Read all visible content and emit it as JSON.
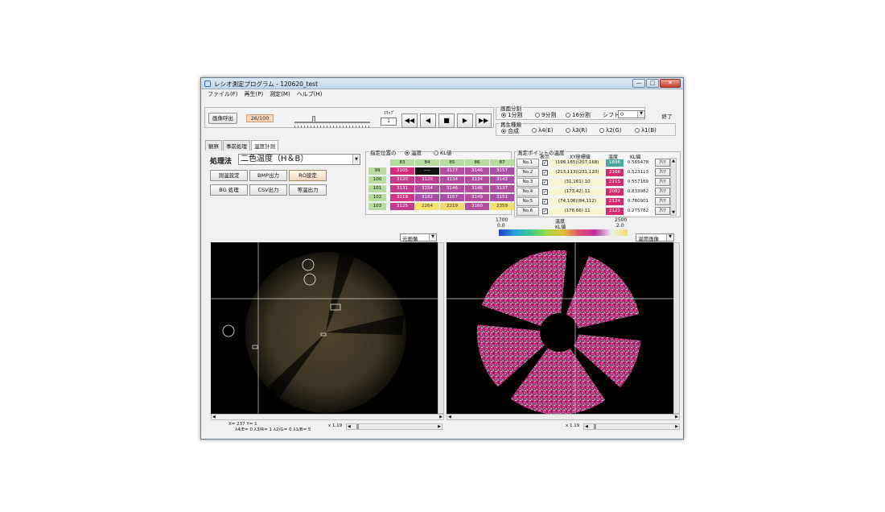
{
  "window": {
    "title": "レシオ測定プログラム - 120620_test",
    "min": "—",
    "max": "□",
    "close": "✕"
  },
  "menu": [
    "ファイル(F)",
    "再生(P)",
    "測定(M)",
    "ヘルプ(H)"
  ],
  "toolbar": {
    "load_button": "画像呼出",
    "frame_counter": "26/100",
    "skip_label": "ｽｷｯﾌﾟ",
    "skip_value": "1",
    "rewind": "◀◀",
    "prev": "◀",
    "stop": "■",
    "play": "▶",
    "ffwd": "▶▶"
  },
  "screen_split": {
    "label": "画面分割",
    "options": [
      "1分割",
      "9分割",
      "16分割"
    ],
    "selected": "1分割",
    "shift_label": "シフト",
    "shift_value": "0",
    "exit_button": "終了"
  },
  "playback_type": {
    "label": "再生種類",
    "options": [
      "合成",
      "λ4(E)",
      "λ3(R)",
      "λ2(G)",
      "λ1(B)"
    ],
    "selected": "合成"
  },
  "tabs": [
    "観察",
    "事前処理",
    "温度計測"
  ],
  "active_tab": "温度計測",
  "method": {
    "label": "処理法",
    "value": "二色温度（H＆B）"
  },
  "buttons": [
    "測温設定",
    "BMP出力",
    "RO設定",
    "BG 処理",
    "CSV出力",
    "等温出力"
  ],
  "position_table": {
    "label": "指定位置の",
    "mode_options": [
      "温度",
      "KL値"
    ],
    "mode_selected": "温度",
    "columns": [
      "83",
      "84",
      "85",
      "86",
      "87"
    ],
    "rows": [
      {
        "y": "99",
        "cells": [
          "3105",
          "----",
          "3177",
          "3146",
          "3157"
        ],
        "colors": [
          "#d42c7a",
          "#111111",
          "#b24ea0",
          "#b24ea0",
          "#a94fa7"
        ]
      },
      {
        "y": "100",
        "cells": [
          "3120",
          "3120",
          "3134",
          "3134",
          "3143"
        ],
        "colors": [
          "#c33b8c",
          "#b83e91",
          "#b24ea0",
          "#b24ea0",
          "#a94fa7"
        ]
      },
      {
        "y": "101",
        "cells": [
          "3131",
          "3154",
          "3146",
          "3146",
          "3137"
        ],
        "colors": [
          "#c33b8c",
          "#b24ea0",
          "#b24ea0",
          "#b24ea0",
          "#b24ea0"
        ]
      },
      {
        "y": "102",
        "cells": [
          "3119",
          "3182",
          "3167",
          "3149",
          "3151"
        ],
        "colors": [
          "#d0378a",
          "#a94fa7",
          "#a94fa7",
          "#b24ea0",
          "#a94fa7"
        ]
      },
      {
        "y": "103",
        "cells": [
          "3125",
          "2264",
          "2219",
          "3160",
          "2359"
        ],
        "colors": [
          "#c33b8c",
          "#f2e36a",
          "#f0d870",
          "#b24ea0",
          "#f3df6b"
        ]
      }
    ]
  },
  "measure_points": {
    "label": "測定ポイントの温度",
    "col_show": "表示",
    "col_xy": "XY座標値",
    "col_temp": "温度",
    "col_kl": "KL値",
    "rows": [
      {
        "no": "No.1",
        "checked": true,
        "xy": "(198,165)(207,168)",
        "temp": "1896",
        "temp_color": "#49a79e",
        "kl": "0.565478",
        "clear": "ｸﾘｱ"
      },
      {
        "no": "No.2",
        "checked": true,
        "xy": "(213,113)(231,120)",
        "temp": "2166",
        "temp_color": "#d22b6f",
        "kl": "0.523113",
        "clear": "ｸﾘｱ"
      },
      {
        "no": "No.3",
        "checked": true,
        "xy": "(31,161) 10",
        "temp": "2115",
        "temp_color": "#d22b6f",
        "kl": "0.557169",
        "clear": "ｸﾘｱ"
      },
      {
        "no": "No.4",
        "checked": true,
        "xy": "(173,42) 11",
        "temp": "2082",
        "temp_color": "#d22b6f",
        "kl": "0.833982",
        "clear": "ｸﾘｱ"
      },
      {
        "no": "No.5",
        "checked": true,
        "xy": "(74,106)(84,112)",
        "temp": "2124",
        "temp_color": "#d22b6f",
        "kl": "0.780901",
        "clear": "ｸﾘｱ"
      },
      {
        "no": "No.6",
        "checked": true,
        "xy": "(178,66) 11",
        "temp": "2121",
        "temp_color": "#d22b6f",
        "kl": "0.275782",
        "clear": "ｸﾘｱ"
      }
    ]
  },
  "colorbar": {
    "min_temp": "1700",
    "min_kl": "0.0",
    "label_temp": "温度",
    "label_kl": "KL値",
    "max_temp": "2500",
    "max_kl": "2.0"
  },
  "left_view": {
    "dropdown": "元画像",
    "status_xy": "X= 237 Y= 1",
    "status_lambda": "λ4/E= 0 λ3/R= 1 λ2/G= 0 λ1/B= 5",
    "zoom": "x 1.19"
  },
  "right_view": {
    "dropdown": "温度画像",
    "zoom": "x 1.19"
  },
  "icons": {
    "app": "app-icon",
    "arrow_left": "◀",
    "arrow_right": "▶",
    "arrow_up": "▲",
    "arrow_down": "▼"
  }
}
